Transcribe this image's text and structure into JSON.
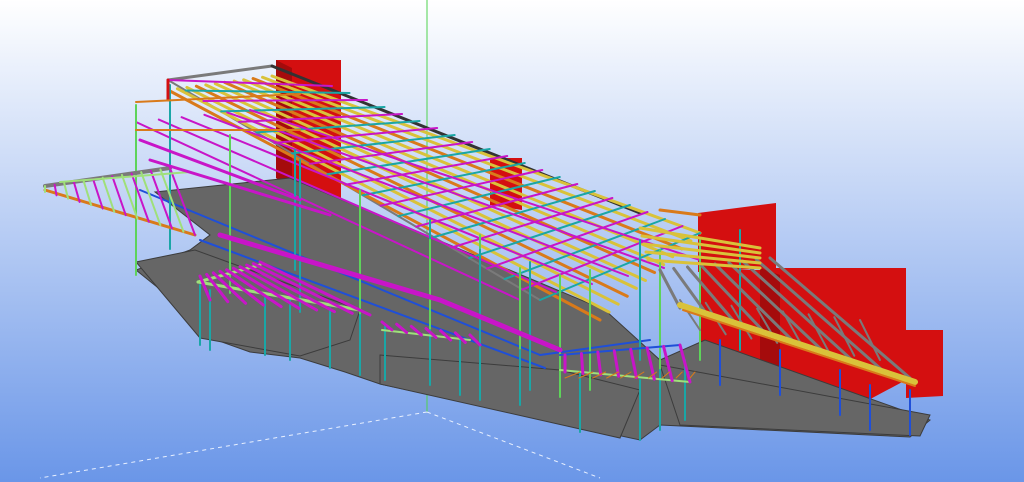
{
  "viewport": {
    "background_top": "#ffffff",
    "background_bottom": "#6a96e8"
  },
  "colors": {
    "slab": "#666666",
    "slab_edge": "#3c3c3c",
    "wall": "#d40f10",
    "wall_dark": "#a50b0c",
    "column_green": "#5ed35a",
    "column_teal": "#1aa6a6",
    "beam_blue": "#1f4fd8",
    "beam_magenta": "#c815c8",
    "beam_yellow": "#d9c23a",
    "beam_orange": "#d97a1a",
    "beam_gray": "#7a7a7a",
    "beam_dark": "#333333",
    "brace_lightgreen": "#9fe07a",
    "axis_green": "#4fd24f",
    "axis_white": "#e8f0ff"
  }
}
